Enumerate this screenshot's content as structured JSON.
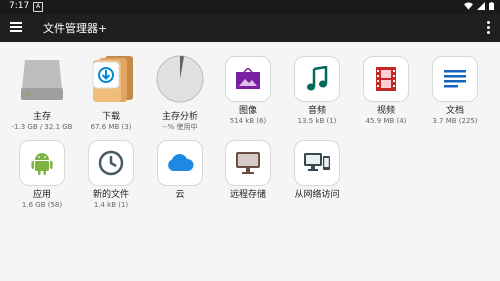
{
  "status": {
    "time": "7:17"
  },
  "appbar": {
    "title": "文件管理器+"
  },
  "tiles": [
    {
      "label": "主存",
      "sub": "-1.3 GB / 32.1 GB"
    },
    {
      "label": "下载",
      "sub": "67.6 MB (3)"
    },
    {
      "label": "主存分析",
      "sub": "--% 使用中"
    },
    {
      "label": "图像",
      "sub": "514 kB (6)"
    },
    {
      "label": "音频",
      "sub": "13.5 kB (1)"
    },
    {
      "label": "视频",
      "sub": "45.9 MB (4)"
    },
    {
      "label": "文档",
      "sub": "3.7 MB (225)"
    },
    {
      "label": "应用",
      "sub": "1.6 GB (58)"
    },
    {
      "label": "新的文件",
      "sub": "1.4 kB (1)"
    },
    {
      "label": "云",
      "sub": ""
    },
    {
      "label": "远程存储",
      "sub": ""
    },
    {
      "label": "从网络访问",
      "sub": ""
    }
  ],
  "colors": {
    "image": "#7b1fa2",
    "audio": "#00695c",
    "video": "#c62828",
    "docs": "#1565c0",
    "apps": "#7cb342",
    "recent": "#455a64",
    "cloud": "#1e88e5",
    "remote": "#6d4c41",
    "network": "#37474f"
  },
  "icons": [
    "drive-icon",
    "download-folder-icon",
    "storage-pie-icon",
    "image-icon",
    "music-icon",
    "video-icon",
    "document-icon",
    "android-icon",
    "clock-icon",
    "cloud-icon",
    "monitor-icon",
    "network-devices-icon"
  ]
}
